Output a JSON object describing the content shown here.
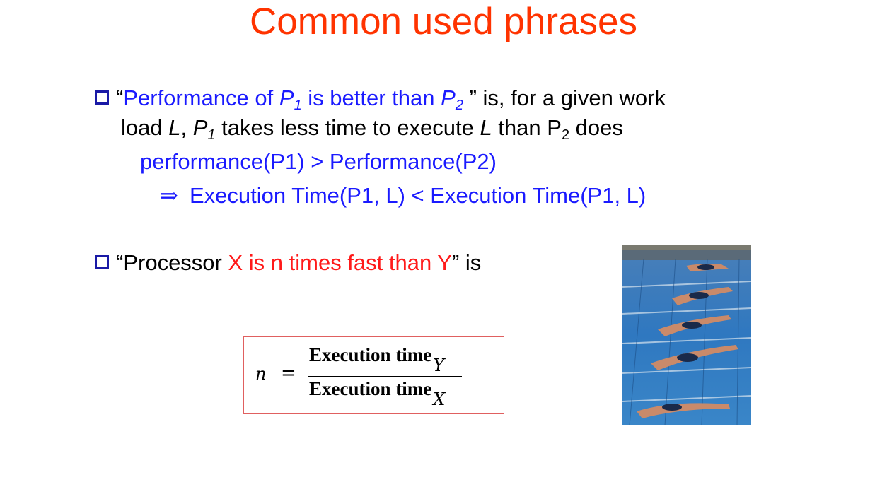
{
  "title": "Common used phrases",
  "bullet1": {
    "open_quote": "“",
    "perf_of": "Performance of ",
    "p": "P",
    "sub1": "1",
    "better_than": " is better than ",
    "sub2": "2",
    "close_quote": " ”",
    "rest1": " is, for a given work",
    "load": "load ",
    "l": "L",
    "comma": ", ",
    "takes": " takes less time to execute ",
    "than_p": " than P",
    "does": " does"
  },
  "perf_line": "performance(P1) > Performance(P2)",
  "implies_symbol": "⇒",
  "exec_line": "Execution Time(P1, L) < Execution Time(P1, L)",
  "bullet2": {
    "open": "“Processor ",
    "highlight": "X is n times fast than Y",
    "close": "” is"
  },
  "formula": {
    "lhs": "n",
    "equals": "=",
    "numerator": "Execution time",
    "numerator_sub": "Y",
    "denominator": "Execution time",
    "denominator_sub": "X"
  },
  "colors": {
    "title": "#ff3300",
    "blue_text": "#1a1aff",
    "red_text": "#ff1a1a",
    "checkbox": "#1a1aa6",
    "formula_border": "#e06060"
  },
  "icons": {
    "bullet": "checkbox-icon"
  },
  "image": {
    "subject": "swimmers diving into pool"
  }
}
